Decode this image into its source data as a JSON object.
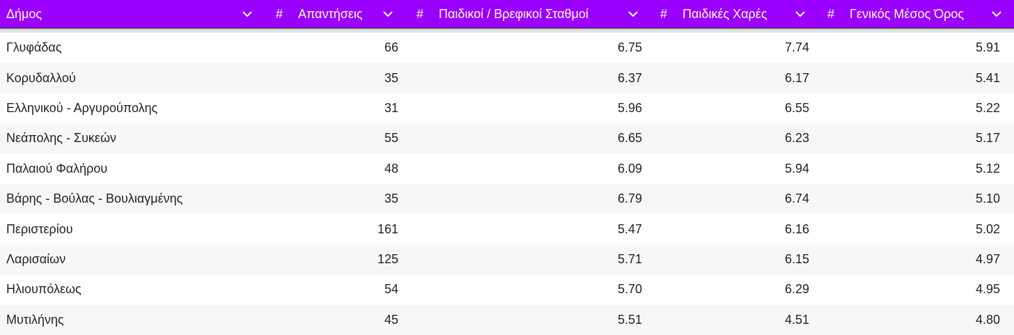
{
  "table": {
    "header_bg": "#9b00ff",
    "columns": [
      {
        "label": "Δήμος",
        "numeric": false
      },
      {
        "label": "Απαντήσεις",
        "numeric": true
      },
      {
        "label": "Παιδικοί / Βρεφικοί Σταθμοί",
        "numeric": true
      },
      {
        "label": "Παιδικές Χαρές",
        "numeric": true
      },
      {
        "label": "Γενικός Μέσος Όρος",
        "numeric": true
      }
    ],
    "numeric_marker": "#",
    "rows": [
      [
        "Γλυφάδας",
        "66",
        "6.75",
        "7.74",
        "5.91"
      ],
      [
        "Κορυδαλλού",
        "35",
        "6.37",
        "6.17",
        "5.41"
      ],
      [
        "Ελληνικού - Αργυρούπολης",
        "31",
        "5.96",
        "6.55",
        "5.22"
      ],
      [
        "Νεάπολης - Συκεών",
        "55",
        "6.65",
        "6.23",
        "5.17"
      ],
      [
        "Παλαιού Φαλήρου",
        "48",
        "6.09",
        "5.94",
        "5.12"
      ],
      [
        "Βάρης - Βούλας - Βουλιαγμένης",
        "35",
        "6.79",
        "6.74",
        "5.10"
      ],
      [
        "Περιστερίου",
        "161",
        "5.47",
        "6.16",
        "5.02"
      ],
      [
        "Λαρισαίων",
        "125",
        "5.71",
        "6.15",
        "4.97"
      ],
      [
        "Ηλιουπόλεως",
        "54",
        "5.70",
        "6.29",
        "4.95"
      ],
      [
        "Μυτιλήνης",
        "45",
        "5.51",
        "4.51",
        "4.80"
      ]
    ]
  }
}
